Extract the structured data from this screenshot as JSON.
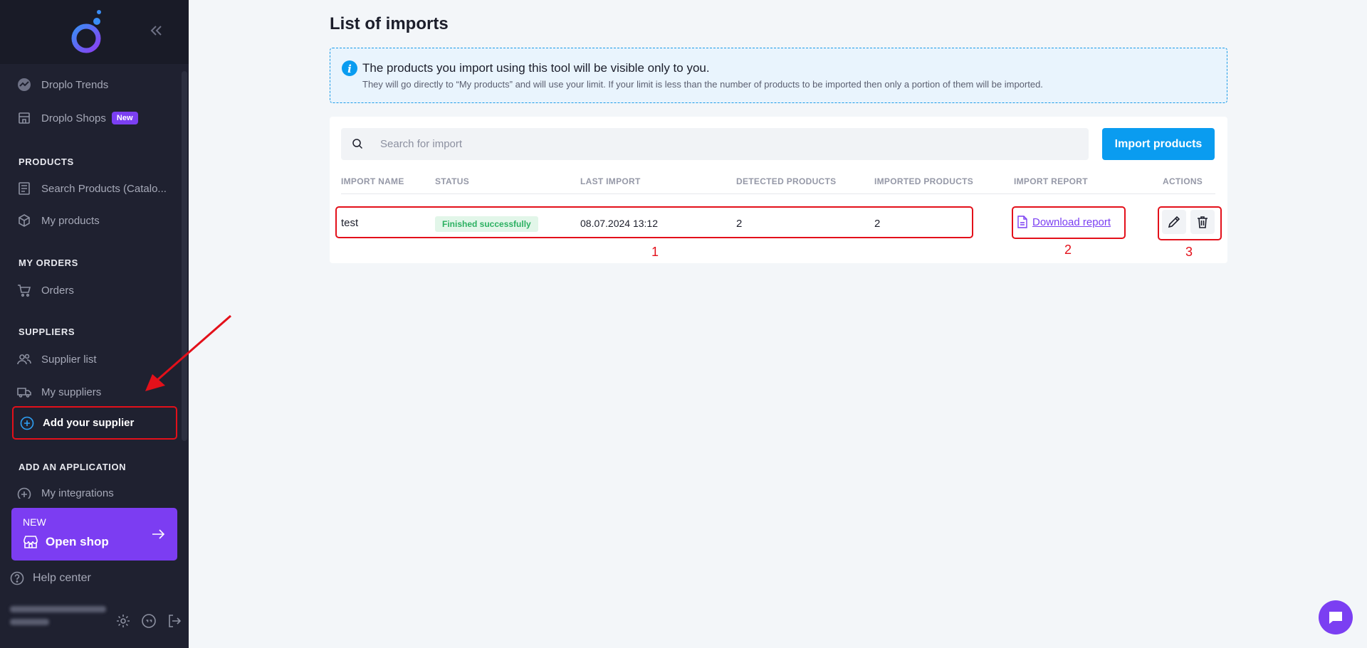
{
  "sidebar": {
    "items_top": [
      {
        "label": "Droplo Trends",
        "icon": "trends-icon"
      },
      {
        "label": "Droplo Shops",
        "icon": "shop-icon",
        "badge": "New"
      }
    ],
    "sections": {
      "products": "PRODUCTS",
      "my_orders": "MY ORDERS",
      "suppliers": "SUPPLIERS",
      "add_application": "ADD AN APPLICATION"
    },
    "products_items": [
      {
        "label": "Search Products (Catalo...",
        "icon": "catalog-icon"
      },
      {
        "label": "My products",
        "icon": "box-icon"
      }
    ],
    "orders_items": [
      {
        "label": "Orders",
        "icon": "cart-icon"
      }
    ],
    "suppliers_items": [
      {
        "label": "Supplier list",
        "icon": "users-icon"
      },
      {
        "label": "My suppliers",
        "icon": "truck-icon"
      }
    ],
    "add_supplier": "Add your supplier",
    "application_items": [
      {
        "label": "My integrations",
        "icon": "plus-circle-icon"
      }
    ],
    "open_shop": {
      "new_label": "NEW",
      "title": "Open shop"
    },
    "help_center": "Help center"
  },
  "main": {
    "title": "List of imports",
    "info": {
      "title": "The products you import using this tool will be visible only to you.",
      "text": "They will go directly to “My products” and will use your limit. If your limit is less than the number of products to be imported then only a portion of them will be imported."
    },
    "search": {
      "placeholder": "Search for import"
    },
    "import_button": "Import products",
    "table": {
      "columns": [
        "IMPORT NAME",
        "STATUS",
        "LAST IMPORT",
        "DETECTED PRODUCTS",
        "IMPORTED PRODUCTS",
        "IMPORT REPORT",
        "ACTIONS"
      ],
      "rows": [
        {
          "name": "test",
          "status": "Finished successfully",
          "last_import": "08.07.2024 13:12",
          "detected": "2",
          "imported": "2",
          "report": "Download report"
        }
      ]
    },
    "annotations": [
      "1",
      "2",
      "3"
    ]
  },
  "colors": {
    "sidebar_bg": "#1f2130",
    "accent_purple": "#7b3ff2",
    "accent_blue": "#0a9cf0",
    "highlight_red": "#e3101a",
    "success_green": "#2bb061"
  }
}
